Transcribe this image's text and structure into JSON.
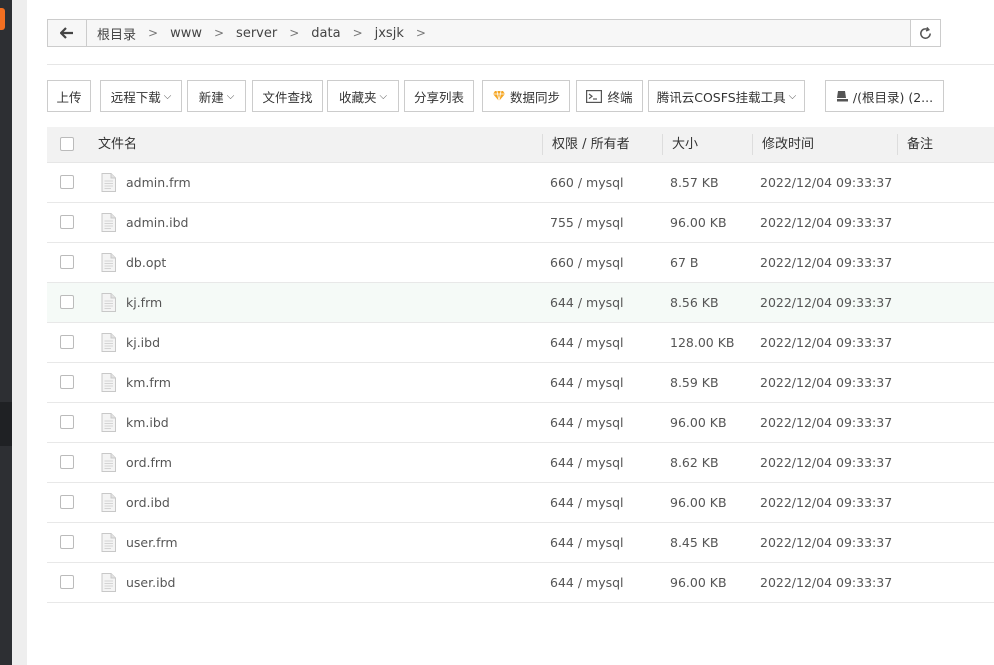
{
  "path": {
    "crumbs": [
      "根目录",
      "www",
      "server",
      "data",
      "jxsjk"
    ],
    "separator": ">"
  },
  "toolbar": {
    "upload": "上传",
    "remote_download": "远程下载",
    "new": "新建",
    "file_search": "文件查找",
    "favorites": "收藏夹",
    "share_list": "分享列表",
    "data_sync": "数据同步",
    "terminal": "终端",
    "cosfs": "腾讯云COSFS挂载工具",
    "disk": "/(根目录) (2..."
  },
  "table": {
    "headers": {
      "name": "文件名",
      "perm": "权限 / 所有者",
      "size": "大小",
      "mtime": "修改时间",
      "note": "备注"
    },
    "rows": [
      {
        "name": "admin.frm",
        "perm": "660 / mysql",
        "size": "8.57 KB",
        "mtime": "2022/12/04 09:33:37"
      },
      {
        "name": "admin.ibd",
        "perm": "755 / mysql",
        "size": "96.00 KB",
        "mtime": "2022/12/04 09:33:37"
      },
      {
        "name": "db.opt",
        "perm": "660 / mysql",
        "size": "67 B",
        "mtime": "2022/12/04 09:33:37"
      },
      {
        "name": "kj.frm",
        "perm": "644 / mysql",
        "size": "8.56 KB",
        "mtime": "2022/12/04 09:33:37"
      },
      {
        "name": "kj.ibd",
        "perm": "644 / mysql",
        "size": "128.00 KB",
        "mtime": "2022/12/04 09:33:37"
      },
      {
        "name": "km.frm",
        "perm": "644 / mysql",
        "size": "8.59 KB",
        "mtime": "2022/12/04 09:33:37"
      },
      {
        "name": "km.ibd",
        "perm": "644 / mysql",
        "size": "96.00 KB",
        "mtime": "2022/12/04 09:33:37"
      },
      {
        "name": "ord.frm",
        "perm": "644 / mysql",
        "size": "8.62 KB",
        "mtime": "2022/12/04 09:33:37"
      },
      {
        "name": "ord.ibd",
        "perm": "644 / mysql",
        "size": "96.00 KB",
        "mtime": "2022/12/04 09:33:37"
      },
      {
        "name": "user.frm",
        "perm": "644 / mysql",
        "size": "8.45 KB",
        "mtime": "2022/12/04 09:33:37"
      },
      {
        "name": "user.ibd",
        "perm": "644 / mysql",
        "size": "96.00 KB",
        "mtime": "2022/12/04 09:33:37"
      }
    ],
    "highlighted_row": 3
  },
  "colors": {
    "brand_accent": "#f36f21",
    "sidebar_bg": "#2d2f33",
    "row_highlight": "#f5faf7",
    "sync_icon": "#f5a623"
  }
}
